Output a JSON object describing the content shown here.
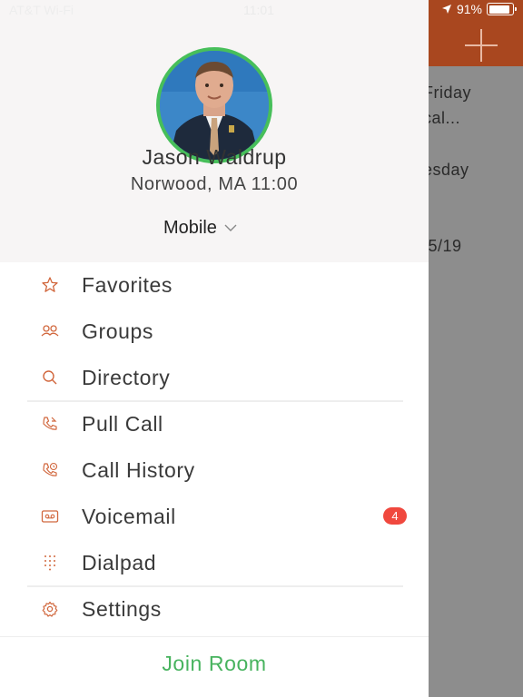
{
  "status_bar": {
    "carrier": "AT&T Wi-Fi",
    "time": "11:01",
    "battery_percent": "91%"
  },
  "background_list": {
    "rows": [
      "Friday",
      "cal...",
      "esday",
      "/5/19"
    ]
  },
  "profile": {
    "name": "Jason Waldrup",
    "location": "Norwood, MA 11:00",
    "device": "Mobile",
    "ring_color": "#47bf5a"
  },
  "menu": {
    "items": [
      {
        "label": "Favorites",
        "icon": "star-icon"
      },
      {
        "label": "Groups",
        "icon": "groups-icon"
      },
      {
        "label": "Directory",
        "icon": "search-icon"
      },
      {
        "label": "Pull Call",
        "icon": "pull-call-icon"
      },
      {
        "label": "Call History",
        "icon": "call-history-icon"
      },
      {
        "label": "Voicemail",
        "icon": "voicemail-icon",
        "badge": "4"
      },
      {
        "label": "Dialpad",
        "icon": "dialpad-icon"
      },
      {
        "label": "Settings",
        "icon": "settings-icon"
      }
    ]
  },
  "footer": {
    "join_room": "Join Room"
  },
  "colors": {
    "accent": "#d1673d",
    "header": "#a9471f",
    "green": "#47b35e",
    "badge": "#f0483e"
  }
}
